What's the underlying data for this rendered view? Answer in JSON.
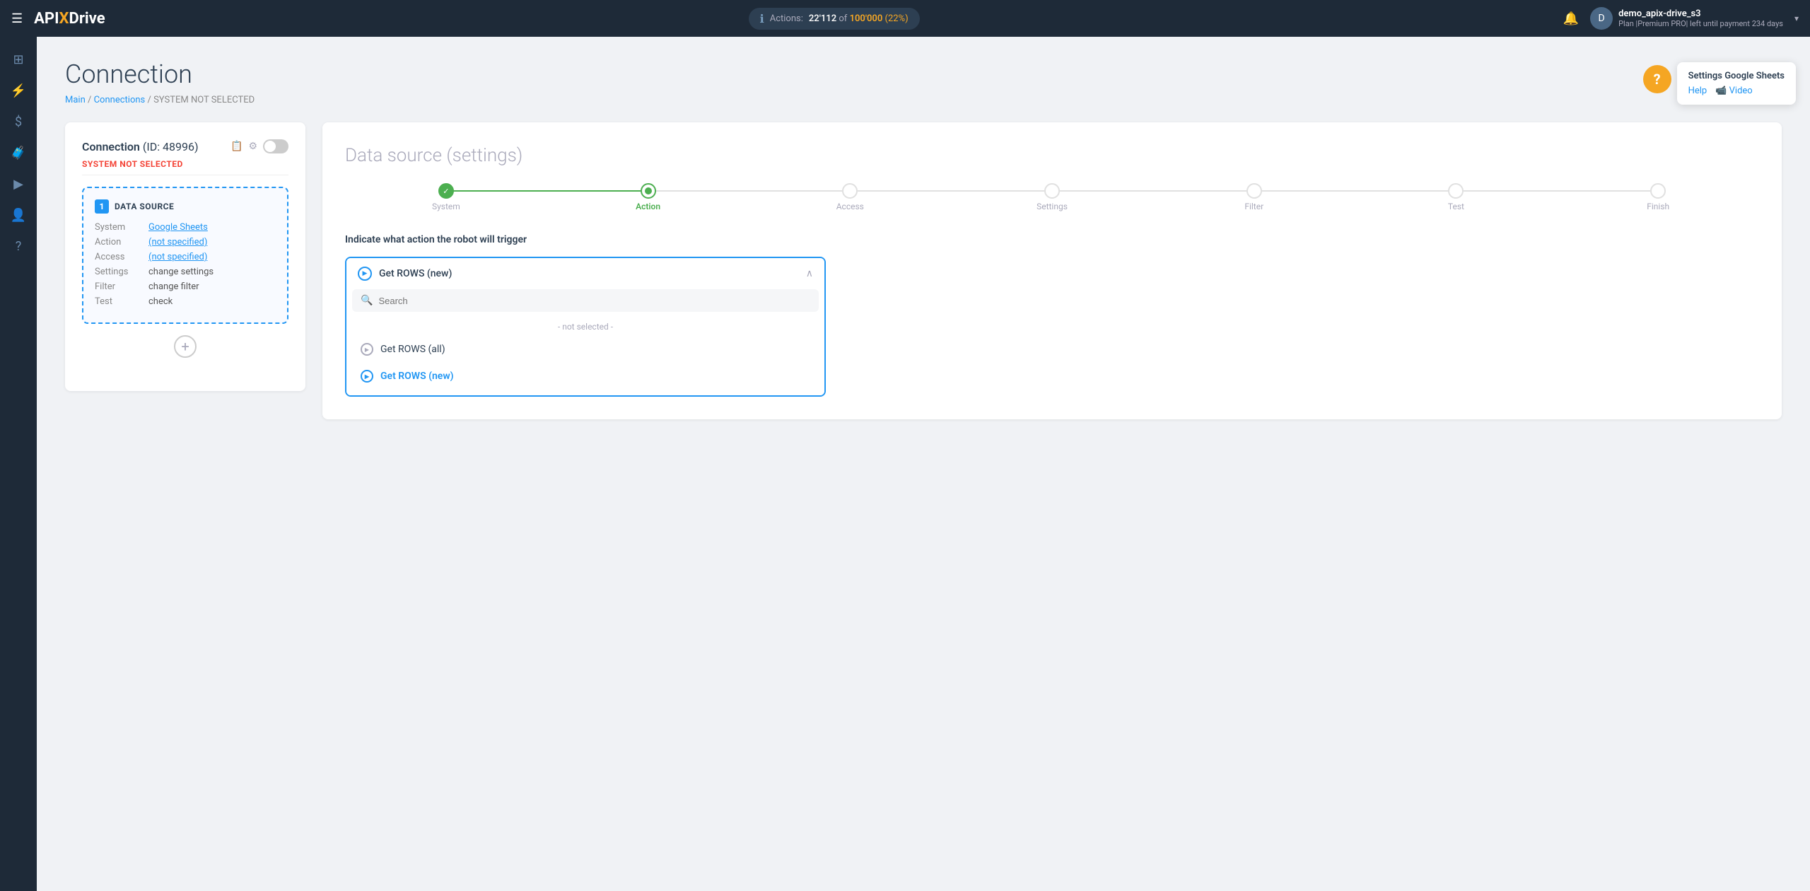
{
  "navbar": {
    "menu_icon": "☰",
    "logo": {
      "api": "API",
      "x": "X",
      "drive": "Drive"
    },
    "actions": {
      "label": "Actions:",
      "used": "22'112",
      "of_text": "of",
      "total": "100'000",
      "percent": "(22%)"
    },
    "user": {
      "name": "demo_apix-drive_s3",
      "plan": "Plan |Premium PRO| left until payment 234 days",
      "avatar_initial": "D"
    },
    "chevron": "▾"
  },
  "sidebar": {
    "items": [
      {
        "icon": "⊞",
        "name": "dashboard"
      },
      {
        "icon": "⚡",
        "name": "connections"
      },
      {
        "icon": "$",
        "name": "billing"
      },
      {
        "icon": "🧳",
        "name": "tasks"
      },
      {
        "icon": "▶",
        "name": "media"
      },
      {
        "icon": "👤",
        "name": "profile"
      },
      {
        "icon": "?",
        "name": "help"
      }
    ]
  },
  "page": {
    "title": "Connection",
    "breadcrumb": {
      "main": "Main",
      "connections": "Connections",
      "current": "SYSTEM NOT SELECTED"
    }
  },
  "connection_card": {
    "title": "Connection",
    "id_part": "(ID: 48996)",
    "system_label": "SYSTEM",
    "not_selected": "NOT SELECTED",
    "datasource_box": {
      "number": "1",
      "header": "DATA SOURCE",
      "rows": [
        {
          "label": "System",
          "value": "Google Sheets",
          "is_link": true
        },
        {
          "label": "Action",
          "value": "(not specified)",
          "is_link": true
        },
        {
          "label": "Access",
          "value": "(not specified)",
          "is_link": true
        },
        {
          "label": "Settings",
          "value": "change settings",
          "is_link": false
        },
        {
          "label": "Filter",
          "value": "change filter",
          "is_link": false
        },
        {
          "label": "Test",
          "value": "check",
          "is_link": false
        }
      ]
    },
    "add_btn_label": "+"
  },
  "datasource_panel": {
    "title": "Data source",
    "title_suffix": "(settings)",
    "steps": [
      {
        "label": "System",
        "state": "completed"
      },
      {
        "label": "Action",
        "state": "active"
      },
      {
        "label": "Access",
        "state": "inactive"
      },
      {
        "label": "Settings",
        "state": "inactive"
      },
      {
        "label": "Filter",
        "state": "inactive"
      },
      {
        "label": "Test",
        "state": "inactive"
      },
      {
        "label": "Finish",
        "state": "inactive"
      }
    ],
    "action_description": "Indicate what action the robot will trigger",
    "dropdown": {
      "selected_label": "Get ROWS (new)",
      "search_placeholder": "Search",
      "not_selected_label": "- not selected -",
      "options": [
        {
          "label": "Get ROWS (all)",
          "selected": false
        },
        {
          "label": "Get ROWS (new)",
          "selected": true
        }
      ]
    }
  },
  "help_widget": {
    "icon": "?",
    "title": "Settings Google Sheets",
    "help_label": "Help",
    "video_label": "📹 Video"
  }
}
